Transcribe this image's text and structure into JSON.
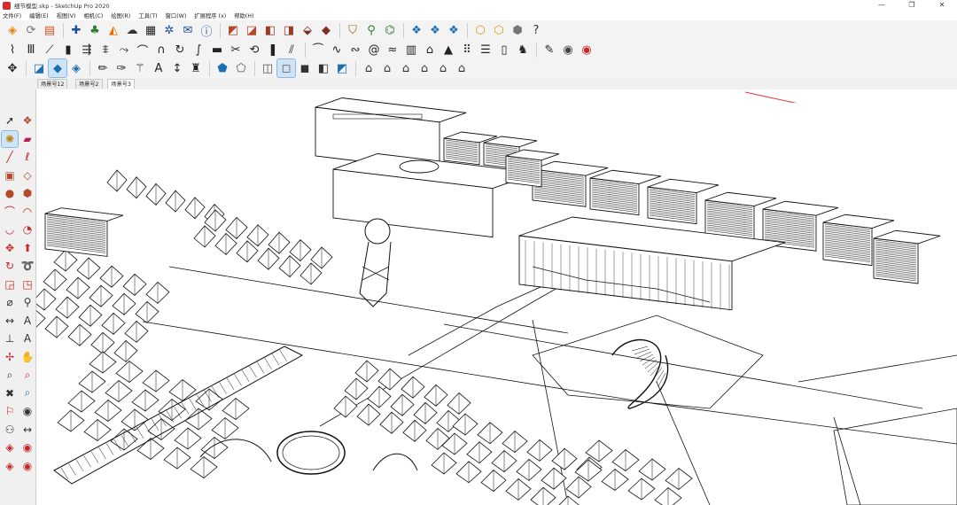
{
  "window": {
    "title": "细节模型.skp - SketchUp Pro 2020",
    "minimize_glyph": "—",
    "maximize_glyph": "❐",
    "close_glyph": "✕"
  },
  "menu": [
    "文件(F)",
    "编辑(E)",
    "视图(V)",
    "相机(C)",
    "绘图(R)",
    "工具(T)",
    "窗口(W)",
    "扩展程序 (x)",
    "帮助(H)"
  ],
  "scene_tabs": [
    "场景号12",
    "场景号2",
    "场景号3"
  ],
  "active_scene_tab": 2,
  "toolbar1_icons": [
    {
      "name": "getting-started-icon",
      "glyph": "◈",
      "color": "#e08a12"
    },
    {
      "name": "refresh-icon",
      "glyph": "⟳",
      "color": "#777"
    },
    {
      "name": "3d-warehouse-icon",
      "glyph": "▤",
      "color": "#d9541a"
    },
    {
      "name": "add-location-icon",
      "glyph": "✚",
      "color": "#1b4e9b"
    },
    {
      "name": "tree-icon",
      "glyph": "♣",
      "color": "#2e7d32"
    },
    {
      "name": "terrain-icon",
      "glyph": "◭",
      "color": "#ef6c00"
    },
    {
      "name": "cloud-icon",
      "glyph": "☁",
      "color": "#333"
    },
    {
      "name": "checker-icon",
      "glyph": "▦",
      "color": "#222"
    },
    {
      "name": "settings-icon",
      "glyph": "✲",
      "color": "#1b4e9b"
    },
    {
      "name": "mail-icon",
      "glyph": "✉",
      "color": "#1b4e9b"
    },
    {
      "name": "info-icon",
      "glyph": "ⓘ",
      "color": "#1b4e9b"
    },
    {
      "name": "extension-a-icon",
      "glyph": "◩",
      "color": "#b24a2a"
    },
    {
      "name": "extension-b-icon",
      "glyph": "◪",
      "color": "#b24a2a"
    },
    {
      "name": "extension-c-icon",
      "glyph": "◧",
      "color": "#9c3a26"
    },
    {
      "name": "extension-d-icon",
      "glyph": "◨",
      "color": "#9c3a26"
    },
    {
      "name": "extension-e-icon",
      "glyph": "⬙",
      "color": "#7a3121"
    },
    {
      "name": "extension-f-icon",
      "glyph": "◆",
      "color": "#7a3121"
    },
    {
      "name": "shield-icon",
      "glyph": "⛉",
      "color": "#8a6d2a"
    },
    {
      "name": "pin-icon",
      "glyph": "⚲",
      "color": "#2e7d32"
    },
    {
      "name": "sandbox-icon",
      "glyph": "⌬",
      "color": "#2e7d32"
    },
    {
      "name": "component-a-icon",
      "glyph": "❖",
      "color": "#1b6fb3"
    },
    {
      "name": "component-b-icon",
      "glyph": "❖",
      "color": "#1b6fb3"
    },
    {
      "name": "component-c-icon",
      "glyph": "❖",
      "color": "#1b6fb3"
    },
    {
      "name": "cube-icon",
      "glyph": "⬡",
      "color": "#d4a017"
    },
    {
      "name": "cube-outline-icon",
      "glyph": "⬡",
      "color": "#d4a017"
    },
    {
      "name": "cube-grey-icon",
      "glyph": "⬢",
      "color": "#777"
    },
    {
      "name": "help-cube-icon",
      "glyph": "?",
      "color": "#333"
    }
  ],
  "toolbar2_icons": [
    {
      "name": "stair-icon",
      "glyph": "⌇",
      "color": "#222"
    },
    {
      "name": "column-icon",
      "glyph": "Ⅲ",
      "color": "#222"
    },
    {
      "name": "ramp-icon",
      "glyph": "⟋",
      "color": "#222"
    },
    {
      "name": "bars-icon",
      "glyph": "▮",
      "color": "#222"
    },
    {
      "name": "railing-icon",
      "glyph": "⇶",
      "color": "#222"
    },
    {
      "name": "fence-icon",
      "glyph": "⩨",
      "color": "#222"
    },
    {
      "name": "path-icon",
      "glyph": "⤳",
      "color": "#222"
    },
    {
      "name": "arc-tool-icon",
      "glyph": "⌒",
      "color": "#222"
    },
    {
      "name": "arch-icon",
      "glyph": "∩",
      "color": "#222"
    },
    {
      "name": "loop-icon",
      "glyph": "↻",
      "color": "#222"
    },
    {
      "name": "curve-icon",
      "glyph": "∫",
      "color": "#222"
    },
    {
      "name": "plate-icon",
      "glyph": "▬",
      "color": "#222"
    },
    {
      "name": "scissors-icon",
      "glyph": "✂",
      "color": "#222"
    },
    {
      "name": "rotate-copy-icon",
      "glyph": "⟲",
      "color": "#222"
    },
    {
      "name": "pillar-icon",
      "glyph": "❚",
      "color": "#222"
    },
    {
      "name": "split-icon",
      "glyph": "⫽",
      "color": "#222"
    },
    {
      "name": "truss-icon",
      "glyph": "⏜",
      "color": "#222"
    },
    {
      "name": "wave-icon",
      "glyph": "∿",
      "color": "#222"
    },
    {
      "name": "spring-icon",
      "glyph": "∾",
      "color": "#222"
    },
    {
      "name": "spiral-icon",
      "glyph": "@",
      "color": "#222"
    },
    {
      "name": "wave2-icon",
      "glyph": "≈",
      "color": "#222"
    },
    {
      "name": "grid-wall-icon",
      "glyph": "▥",
      "color": "#222"
    },
    {
      "name": "building-icon",
      "glyph": "⌂",
      "color": "#222"
    },
    {
      "name": "pyramid-icon",
      "glyph": "▲",
      "color": "#222"
    },
    {
      "name": "dots-icon",
      "glyph": "⠿",
      "color": "#222"
    },
    {
      "name": "stack-icon",
      "glyph": "☰",
      "color": "#222"
    },
    {
      "name": "panel-icon",
      "glyph": "▯",
      "color": "#222"
    },
    {
      "name": "figure-icon",
      "glyph": "♞",
      "color": "#222"
    },
    {
      "name": "brush-icon",
      "glyph": "✎",
      "color": "#222"
    },
    {
      "name": "camera-icon",
      "glyph": "◉",
      "color": "#444"
    },
    {
      "name": "record-icon",
      "glyph": "◉",
      "color": "#c62828"
    }
  ],
  "toolbar3_icons": [
    {
      "name": "axis-icon",
      "glyph": "✥",
      "color": "#222"
    },
    {
      "name": "view-iso-icon",
      "glyph": "◪",
      "color": "#1b6fb3"
    },
    {
      "name": "view-top-icon",
      "glyph": "◆",
      "color": "#1b6fb3",
      "selected": true
    },
    {
      "name": "view-front-icon",
      "glyph": "◈",
      "color": "#1b6fb3"
    },
    {
      "name": "pencil-icon",
      "glyph": "✏",
      "color": "#222"
    },
    {
      "name": "eraser-style-icon",
      "glyph": "✑",
      "color": "#222"
    },
    {
      "name": "wand-icon",
      "glyph": "⚚",
      "color": "#222"
    },
    {
      "name": "text-icon",
      "glyph": "A",
      "color": "#222"
    },
    {
      "name": "dimension-icon",
      "glyph": "↕",
      "color": "#222"
    },
    {
      "name": "figure2-icon",
      "glyph": "♜",
      "color": "#222"
    },
    {
      "name": "shade-a-icon",
      "glyph": "⬟",
      "color": "#1b6fb3"
    },
    {
      "name": "shade-b-icon",
      "glyph": "⬠",
      "color": "#555"
    },
    {
      "name": "style-xray-icon",
      "glyph": "◫",
      "color": "#555"
    },
    {
      "name": "style-hidden-icon",
      "glyph": "◻",
      "color": "#555",
      "selected": true
    },
    {
      "name": "style-shaded-icon",
      "glyph": "◼",
      "color": "#333"
    },
    {
      "name": "style-texture-icon",
      "glyph": "◧",
      "color": "#333"
    },
    {
      "name": "style-mono-icon",
      "glyph": "◩",
      "color": "#1b6fb3"
    },
    {
      "name": "house-a-icon",
      "glyph": "⌂",
      "color": "#333"
    },
    {
      "name": "house-b-icon",
      "glyph": "⌂",
      "color": "#333"
    },
    {
      "name": "house-c-icon",
      "glyph": "⌂",
      "color": "#333"
    },
    {
      "name": "house-d-icon",
      "glyph": "⌂",
      "color": "#333"
    },
    {
      "name": "house-e-icon",
      "glyph": "⌂",
      "color": "#333"
    },
    {
      "name": "house-f-icon",
      "glyph": "⌂",
      "color": "#333"
    }
  ],
  "palette_icons": [
    {
      "name": "select-tool-icon",
      "glyph": "➚",
      "color": "#222"
    },
    {
      "name": "component-tool-icon",
      "glyph": "❖",
      "color": "#b24a2a"
    },
    {
      "name": "paint-bucket-icon",
      "glyph": "✺",
      "color": "#b8860b",
      "selected": true
    },
    {
      "name": "eraser-icon",
      "glyph": "▰",
      "color": "#c2185b"
    },
    {
      "name": "line-tool-icon",
      "glyph": "╱",
      "color": "#c62828"
    },
    {
      "name": "freehand-icon",
      "glyph": "ℓ",
      "color": "#c62828"
    },
    {
      "name": "rectangle-icon",
      "glyph": "▣",
      "color": "#b24a2a"
    },
    {
      "name": "rotated-rect-icon",
      "glyph": "◇",
      "color": "#b24a2a"
    },
    {
      "name": "circle-icon",
      "glyph": "●",
      "color": "#b24a2a"
    },
    {
      "name": "polygon-icon",
      "glyph": "⬢",
      "color": "#b24a2a"
    },
    {
      "name": "arc-icon",
      "glyph": "⌒",
      "color": "#c62828"
    },
    {
      "name": "arc2-icon",
      "glyph": "◠",
      "color": "#c62828"
    },
    {
      "name": "arc3-icon",
      "glyph": "◡",
      "color": "#c62828"
    },
    {
      "name": "pie-icon",
      "glyph": "◔",
      "color": "#c62828"
    },
    {
      "name": "move-icon",
      "glyph": "✥",
      "color": "#c62828"
    },
    {
      "name": "push-pull-icon",
      "glyph": "⬆",
      "color": "#c62828"
    },
    {
      "name": "rotate-icon",
      "glyph": "↻",
      "color": "#c62828"
    },
    {
      "name": "follow-me-icon",
      "glyph": "➰",
      "color": "#c62828"
    },
    {
      "name": "scale-icon",
      "glyph": "◲",
      "color": "#c62828"
    },
    {
      "name": "offset-icon",
      "glyph": "◳",
      "color": "#c62828"
    },
    {
      "name": "tape-measure-icon",
      "glyph": "⌀",
      "color": "#333"
    },
    {
      "name": "protractor-icon",
      "glyph": "⚲",
      "color": "#333"
    },
    {
      "name": "dimension-tool-icon",
      "glyph": "↔",
      "color": "#333"
    },
    {
      "name": "text-tool-icon",
      "glyph": "A",
      "color": "#333"
    },
    {
      "name": "axes-tool-icon",
      "glyph": "⊥",
      "color": "#333"
    },
    {
      "name": "3d-text-icon",
      "glyph": "A",
      "color": "#333"
    },
    {
      "name": "orbit-icon",
      "glyph": "✢",
      "color": "#c62828"
    },
    {
      "name": "pan-icon",
      "glyph": "✋",
      "color": "#333"
    },
    {
      "name": "zoom-icon",
      "glyph": "⌕",
      "color": "#333"
    },
    {
      "name": "zoom-window-icon",
      "glyph": "⌕",
      "color": "#c62828"
    },
    {
      "name": "zoom-extents-icon",
      "glyph": "✖",
      "color": "#333"
    },
    {
      "name": "previous-view-icon",
      "glyph": "⌕",
      "color": "#1b6fb3"
    },
    {
      "name": "position-camera-icon",
      "glyph": "⚐",
      "color": "#c62828"
    },
    {
      "name": "look-around-icon",
      "glyph": "◉",
      "color": "#333"
    },
    {
      "name": "walk-icon",
      "glyph": "⚇",
      "color": "#333"
    },
    {
      "name": "section-plane-icon",
      "glyph": "↔",
      "color": "#333"
    },
    {
      "name": "ext-tool-a-icon",
      "glyph": "◈",
      "color": "#c62828"
    },
    {
      "name": "ext-tool-b-icon",
      "glyph": "◉",
      "color": "#c62828"
    },
    {
      "name": "ext-tool-c-icon",
      "glyph": "◈",
      "color": "#c62828"
    },
    {
      "name": "ext-tool-d-icon",
      "glyph": "◉",
      "color": "#c62828"
    }
  ]
}
